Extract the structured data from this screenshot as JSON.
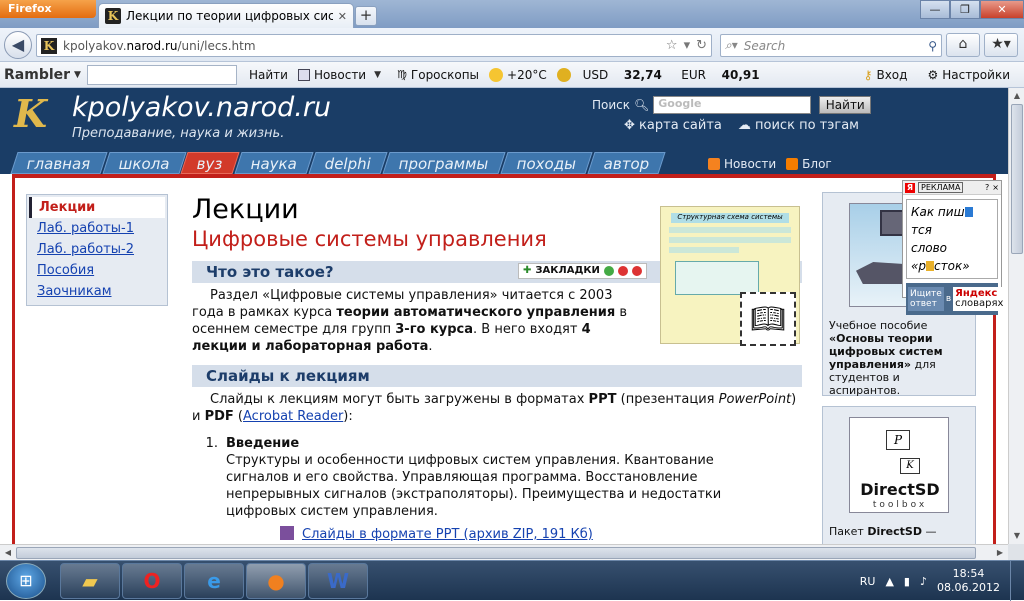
{
  "browser": {
    "app_button": "Firefox",
    "tab_title": "Лекции по теории цифровых систем а...",
    "url_prefix": "kpolyakov.",
    "url_host": "narod.ru",
    "url_path": "/uni/lecs.htm",
    "search_placeholder": "Search"
  },
  "rambler": {
    "logo": "Rambler",
    "find": "Найти",
    "news": "Новости",
    "horoscope": "Гороскопы",
    "temp": "+20°C",
    "usd_label": "USD",
    "usd": "32,74",
    "eur_label": "EUR",
    "eur": "40,91",
    "login": "Вход",
    "settings": "Настройки"
  },
  "site": {
    "logo_letter": "K",
    "name": "kpolyakov.narod.ru",
    "tagline": "Преподавание, наука и жизнь.",
    "search_label": "Поиск",
    "search_placeholder": "Google",
    "search_button": "Найти",
    "sitemap": "карта сайта",
    "tag_search": "поиск по тэгам",
    "tabs": [
      "главная",
      "школа",
      "вуз",
      "наука",
      "delphi",
      "программы",
      "походы",
      "автор"
    ],
    "news": "Новости",
    "blog": "Блог"
  },
  "left_menu": [
    "Лекции",
    "Лаб. работы-1",
    "Лаб. работы-2",
    "Пособия",
    "Заочникам"
  ],
  "main": {
    "title": "Лекции",
    "subtitle": "Цифровые системы управления",
    "section1": "Что это такое?",
    "bookmarks": "ЗАКЛАДКИ",
    "p1_a": "Раздел «Цифровые системы управления» читается с 2003 года в рамках курса ",
    "p1_b": "теории автоматического управления",
    "p1_c": " в осеннем семестре для групп ",
    "p1_d": "3-го курса",
    "p1_e": ". В него входят ",
    "p1_f": "4 лекции и лабораторная работа",
    "p1_g": ".",
    "section2": "Слайды к лекциям",
    "p2_a": "Слайды к лекциям могут быть загружены в форматах ",
    "p2_b": "PPT",
    "p2_c": " (презентация ",
    "p2_d": "PowerPoint",
    "p2_e": ") и ",
    "p2_f": "PDF",
    "p2_g": " (",
    "p2_link": "Acrobat Reader",
    "p2_h": "):",
    "item1_num": "1.",
    "item1_title": "Введение",
    "item1_text": "Структуры и особенности цифровых систем управления. Квантование сигналов и его свойства. Управляющая программа. Восстановление непрерывных сигналов (экстраполяторы). Преимущества и недостатки цифровых систем управления.",
    "item1_link": "Слайды в формате PPT (архив ZIP, 191 Кб)",
    "slide_title": "Структурная схема системы"
  },
  "right": {
    "book_text_a": "Учебное пособие ",
    "book_text_b": "«Основы теории цифровых систем управления»",
    "book_text_c": " для студентов и аспирантов.",
    "ds_p": "P",
    "ds_k": "K",
    "ds_title": "DirectSD",
    "ds_sub": "toolbox",
    "ds_text_a": "Пакет ",
    "ds_text_b": "DirectSD",
    "ds_text_c": " —"
  },
  "yad": {
    "ya": "Я",
    "label": "РЕКЛАМА",
    "q": "?",
    "x": "×",
    "line1_a": "Как пиш",
    "line1_b": "тся",
    "line2": "слово",
    "line3_a": "«р",
    "line3_b": "сток»",
    "ask": "Ищите ответ",
    "in": "в",
    "brand": "Яндекс",
    "brand_sub": "словарях"
  },
  "taskbar": {
    "lang": "RU",
    "time": "18:54",
    "date": "08.06.2012"
  }
}
